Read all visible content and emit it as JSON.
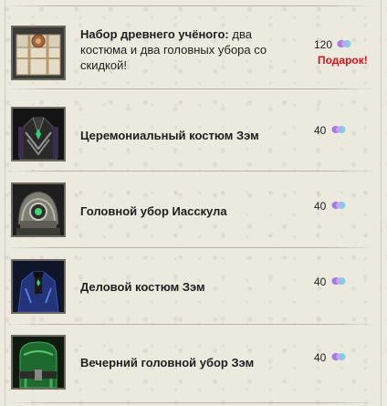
{
  "items": [
    {
      "title_bold": "Набор древнего учёного:",
      "title_rest": " два костюма и два головных убора со скидкой!",
      "price": "120",
      "badge": "Подарок!",
      "image_icon": "treasure-chest-icon"
    },
    {
      "title_bold": "Церемониальный костюм Зэм",
      "title_rest": "",
      "price": "40",
      "badge": "",
      "image_icon": "ceremonial-costume-icon"
    },
    {
      "title_bold": "Головной убор Иасскула",
      "title_rest": "",
      "price": "40",
      "badge": "",
      "image_icon": "helmet-icon"
    },
    {
      "title_bold": "Деловой костюм Зэм",
      "title_rest": "",
      "price": "40",
      "badge": "",
      "image_icon": "business-suit-icon"
    },
    {
      "title_bold": "Вечерний головной убор Зэм",
      "title_rest": "",
      "price": "40",
      "badge": "",
      "image_icon": "evening-headgear-icon"
    }
  ],
  "currency_icon": "gem-currency-icon",
  "colors": {
    "background": "#ece9df",
    "gift_text": "#d2161b",
    "gem": "#a57be0"
  }
}
